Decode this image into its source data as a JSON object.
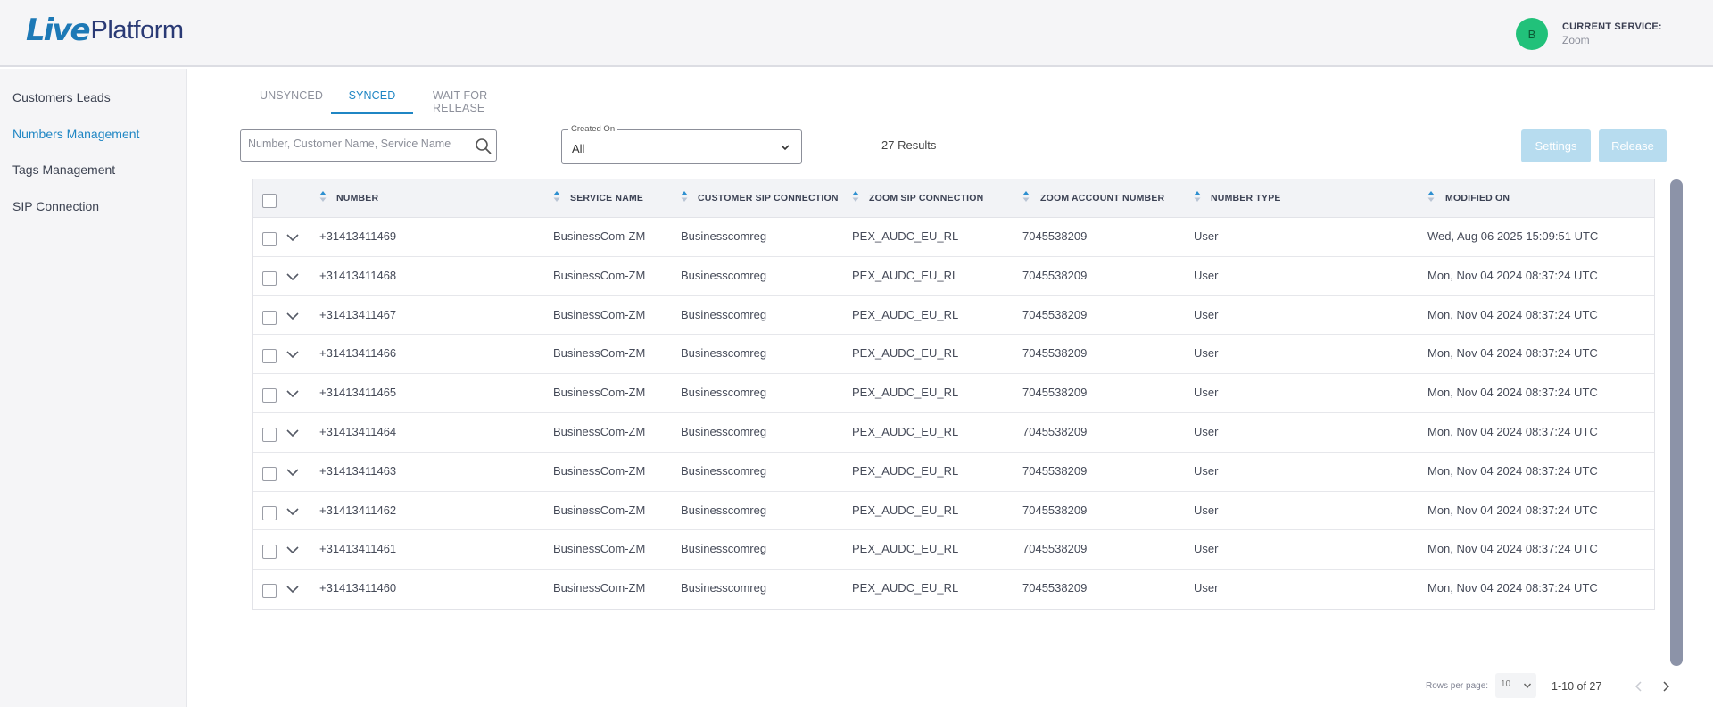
{
  "header": {
    "logo_live": "Live",
    "logo_platform": "Platform",
    "avatar_initial": "B",
    "current_service_label": "CURRENT SERVICE:",
    "current_service_value": "Zoom"
  },
  "sidebar": {
    "items": [
      {
        "label": "Customers Leads",
        "active": false
      },
      {
        "label": "Numbers Management",
        "active": true
      },
      {
        "label": "Tags Management",
        "active": false
      },
      {
        "label": "SIP Connection",
        "active": false
      }
    ]
  },
  "tabs": [
    {
      "label": "UNSYNCED",
      "active": false
    },
    {
      "label": "SYNCED",
      "active": true
    },
    {
      "label": "WAIT FOR RELEASE",
      "active": false
    }
  ],
  "search": {
    "placeholder": "Number, Customer Name, Service Name",
    "value": ""
  },
  "created_on": {
    "label": "Created On",
    "value": "All"
  },
  "results_text": "27 Results",
  "buttons": {
    "settings": "Settings",
    "release": "Release"
  },
  "table": {
    "columns": [
      "NUMBER",
      "SERVICE NAME",
      "CUSTOMER SIP CONNECTION",
      "ZOOM SIP CONNECTION",
      "ZOOM ACCOUNT NUMBER",
      "NUMBER TYPE",
      "MODIFIED ON"
    ],
    "rows": [
      [
        "+31413411469",
        "BusinessCom-ZM",
        "Businesscomreg",
        "PEX_AUDC_EU_RL",
        "7045538209",
        "User",
        "Wed, Aug 06 2025 15:09:51 UTC"
      ],
      [
        "+31413411468",
        "BusinessCom-ZM",
        "Businesscomreg",
        "PEX_AUDC_EU_RL",
        "7045538209",
        "User",
        "Mon, Nov 04 2024 08:37:24 UTC"
      ],
      [
        "+31413411467",
        "BusinessCom-ZM",
        "Businesscomreg",
        "PEX_AUDC_EU_RL",
        "7045538209",
        "User",
        "Mon, Nov 04 2024 08:37:24 UTC"
      ],
      [
        "+31413411466",
        "BusinessCom-ZM",
        "Businesscomreg",
        "PEX_AUDC_EU_RL",
        "7045538209",
        "User",
        "Mon, Nov 04 2024 08:37:24 UTC"
      ],
      [
        "+31413411465",
        "BusinessCom-ZM",
        "Businesscomreg",
        "PEX_AUDC_EU_RL",
        "7045538209",
        "User",
        "Mon, Nov 04 2024 08:37:24 UTC"
      ],
      [
        "+31413411464",
        "BusinessCom-ZM",
        "Businesscomreg",
        "PEX_AUDC_EU_RL",
        "7045538209",
        "User",
        "Mon, Nov 04 2024 08:37:24 UTC"
      ],
      [
        "+31413411463",
        "BusinessCom-ZM",
        "Businesscomreg",
        "PEX_AUDC_EU_RL",
        "7045538209",
        "User",
        "Mon, Nov 04 2024 08:37:24 UTC"
      ],
      [
        "+31413411462",
        "BusinessCom-ZM",
        "Businesscomreg",
        "PEX_AUDC_EU_RL",
        "7045538209",
        "User",
        "Mon, Nov 04 2024 08:37:24 UTC"
      ],
      [
        "+31413411461",
        "BusinessCom-ZM",
        "Businesscomreg",
        "PEX_AUDC_EU_RL",
        "7045538209",
        "User",
        "Mon, Nov 04 2024 08:37:24 UTC"
      ],
      [
        "+31413411460",
        "BusinessCom-ZM",
        "Businesscomreg",
        "PEX_AUDC_EU_RL",
        "7045538209",
        "User",
        "Mon, Nov 04 2024 08:37:24 UTC"
      ]
    ]
  },
  "pagination": {
    "rows_per_page_label": "Rows per page:",
    "rows_per_page_value": "10",
    "range_text": "1-10 of 27"
  },
  "colors": {
    "accent": "#1f86c4",
    "avatar": "#21c17a",
    "button_disabled": "#b7dcef",
    "scrollbar": "#8c93a8"
  }
}
